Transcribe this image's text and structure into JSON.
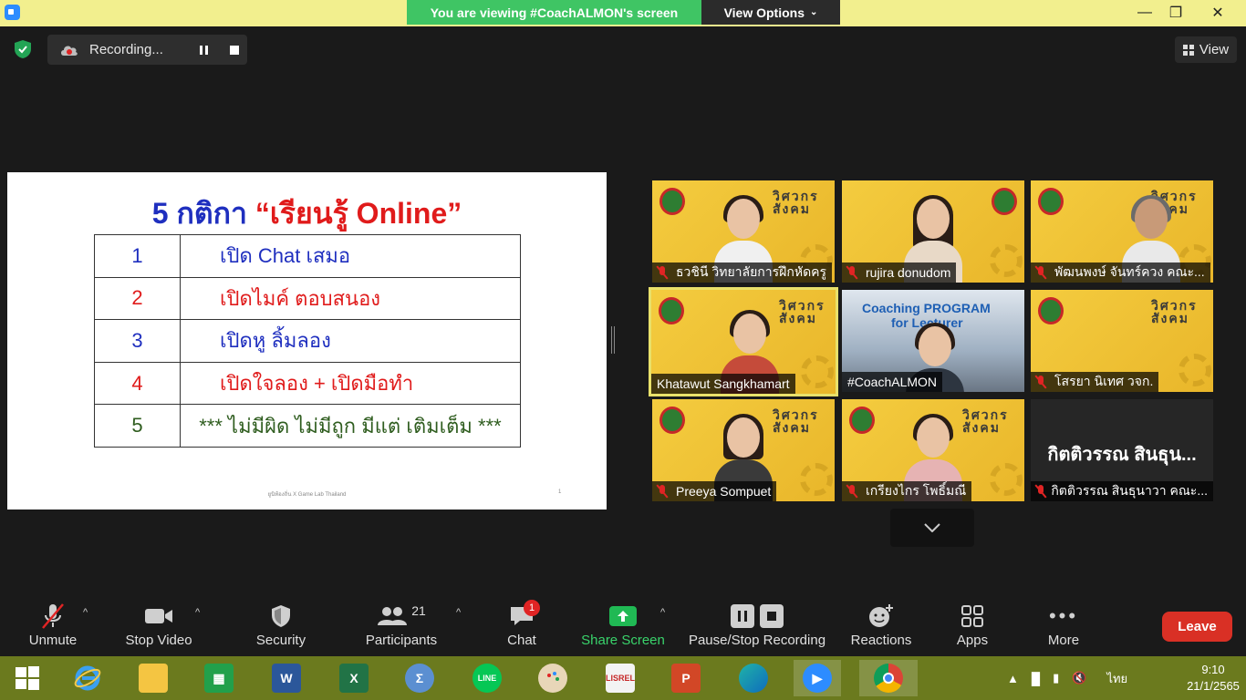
{
  "top_bar": {
    "viewing_banner": "You are viewing #CoachALMON's screen",
    "view_options_label": "View Options"
  },
  "recording": {
    "label": "Recording..."
  },
  "view_button_label": "View",
  "slide": {
    "title_prefix": "5 กติกา",
    "title_quote": "“เรียนรู้ Online”",
    "rules": [
      {
        "num": "1",
        "text": "เปิด Chat เสมอ",
        "color": "#1f2fbf"
      },
      {
        "num": "2",
        "text": "เปิดไมค์ ตอบสนอง",
        "color": "#e01b1b"
      },
      {
        "num": "3",
        "text": "เปิดหู ลิ้มลอง",
        "color": "#1f2fbf"
      },
      {
        "num": "4",
        "text": "เปิดใจลอง + เปิดมือทำ",
        "color": "#e01b1b"
      },
      {
        "num": "5",
        "text": "*** ไม่มีผิด ไม่มีถูก มีแต่ เติมเต็ม ***",
        "color": "#2f5d1f"
      }
    ],
    "footer": "ยูนิท้องถิ่น X Game Lab Thailand",
    "page": "1"
  },
  "gallery": {
    "tiles": [
      {
        "name": "ธวชินี วิทยาลัยการฝึกหัดครู",
        "muted": true
      },
      {
        "name": "rujira donudom",
        "muted": true
      },
      {
        "name": "พัฒนพงษ์ จันทร์ควง คณะ...",
        "muted": true
      },
      {
        "name": "Khatawut Sangkhamart",
        "muted": false
      },
      {
        "name": "#CoachALMON",
        "muted": false
      },
      {
        "name": "โสรยา นิเทศ วจก.",
        "muted": true
      },
      {
        "name": "Preeya Sompuet",
        "muted": true
      },
      {
        "name": "เกรียงไกร โพธิ์มณี",
        "muted": true
      },
      {
        "name": "กิตติวรรณ สินธุนาวา คณะ...",
        "muted": true
      }
    ],
    "brand_text": "วิศวกรสังคม",
    "coach_banner_line1": "Coaching PROGRAM",
    "coach_banner_line2": "for Lecturer",
    "big_name_tile": "กิตติวรรณ สินธุน..."
  },
  "toolbar": {
    "unmute": "Unmute",
    "stop_video": "Stop Video",
    "security": "Security",
    "participants": "Participants",
    "participants_count": "21",
    "chat": "Chat",
    "chat_badge": "1",
    "share_screen": "Share Screen",
    "pause_stop_recording": "Pause/Stop Recording",
    "reactions": "Reactions",
    "apps": "Apps",
    "more": "More",
    "leave": "Leave"
  },
  "taskbar": {
    "language": "ไทย",
    "time": "9:10",
    "date": "21/1/2565"
  },
  "colors": {
    "banner_green": "#3fc564",
    "leave_red": "#d93025",
    "taskbar": "#6b7a1e",
    "top_bar": "#f2ef8e"
  }
}
